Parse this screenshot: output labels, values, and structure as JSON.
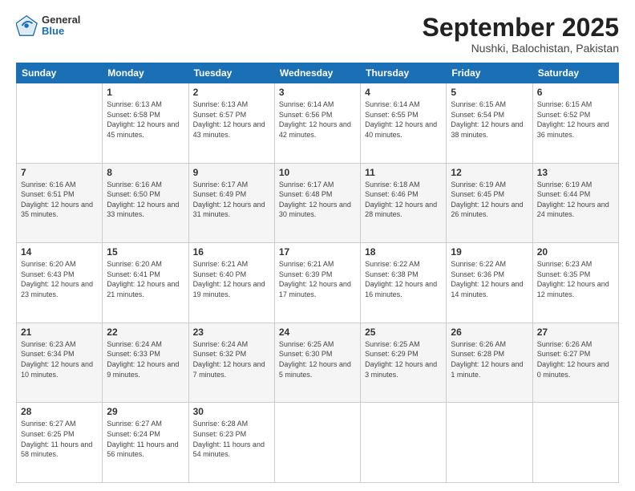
{
  "logo": {
    "general": "General",
    "blue": "Blue"
  },
  "header": {
    "month": "September 2025",
    "location": "Nushki, Balochistan, Pakistan"
  },
  "weekdays": [
    "Sunday",
    "Monday",
    "Tuesday",
    "Wednesday",
    "Thursday",
    "Friday",
    "Saturday"
  ],
  "weeks": [
    [
      {
        "day": "",
        "sunrise": "",
        "sunset": "",
        "daylight": ""
      },
      {
        "day": "1",
        "sunrise": "Sunrise: 6:13 AM",
        "sunset": "Sunset: 6:58 PM",
        "daylight": "Daylight: 12 hours and 45 minutes."
      },
      {
        "day": "2",
        "sunrise": "Sunrise: 6:13 AM",
        "sunset": "Sunset: 6:57 PM",
        "daylight": "Daylight: 12 hours and 43 minutes."
      },
      {
        "day": "3",
        "sunrise": "Sunrise: 6:14 AM",
        "sunset": "Sunset: 6:56 PM",
        "daylight": "Daylight: 12 hours and 42 minutes."
      },
      {
        "day": "4",
        "sunrise": "Sunrise: 6:14 AM",
        "sunset": "Sunset: 6:55 PM",
        "daylight": "Daylight: 12 hours and 40 minutes."
      },
      {
        "day": "5",
        "sunrise": "Sunrise: 6:15 AM",
        "sunset": "Sunset: 6:54 PM",
        "daylight": "Daylight: 12 hours and 38 minutes."
      },
      {
        "day": "6",
        "sunrise": "Sunrise: 6:15 AM",
        "sunset": "Sunset: 6:52 PM",
        "daylight": "Daylight: 12 hours and 36 minutes."
      }
    ],
    [
      {
        "day": "7",
        "sunrise": "Sunrise: 6:16 AM",
        "sunset": "Sunset: 6:51 PM",
        "daylight": "Daylight: 12 hours and 35 minutes."
      },
      {
        "day": "8",
        "sunrise": "Sunrise: 6:16 AM",
        "sunset": "Sunset: 6:50 PM",
        "daylight": "Daylight: 12 hours and 33 minutes."
      },
      {
        "day": "9",
        "sunrise": "Sunrise: 6:17 AM",
        "sunset": "Sunset: 6:49 PM",
        "daylight": "Daylight: 12 hours and 31 minutes."
      },
      {
        "day": "10",
        "sunrise": "Sunrise: 6:17 AM",
        "sunset": "Sunset: 6:48 PM",
        "daylight": "Daylight: 12 hours and 30 minutes."
      },
      {
        "day": "11",
        "sunrise": "Sunrise: 6:18 AM",
        "sunset": "Sunset: 6:46 PM",
        "daylight": "Daylight: 12 hours and 28 minutes."
      },
      {
        "day": "12",
        "sunrise": "Sunrise: 6:19 AM",
        "sunset": "Sunset: 6:45 PM",
        "daylight": "Daylight: 12 hours and 26 minutes."
      },
      {
        "day": "13",
        "sunrise": "Sunrise: 6:19 AM",
        "sunset": "Sunset: 6:44 PM",
        "daylight": "Daylight: 12 hours and 24 minutes."
      }
    ],
    [
      {
        "day": "14",
        "sunrise": "Sunrise: 6:20 AM",
        "sunset": "Sunset: 6:43 PM",
        "daylight": "Daylight: 12 hours and 23 minutes."
      },
      {
        "day": "15",
        "sunrise": "Sunrise: 6:20 AM",
        "sunset": "Sunset: 6:41 PM",
        "daylight": "Daylight: 12 hours and 21 minutes."
      },
      {
        "day": "16",
        "sunrise": "Sunrise: 6:21 AM",
        "sunset": "Sunset: 6:40 PM",
        "daylight": "Daylight: 12 hours and 19 minutes."
      },
      {
        "day": "17",
        "sunrise": "Sunrise: 6:21 AM",
        "sunset": "Sunset: 6:39 PM",
        "daylight": "Daylight: 12 hours and 17 minutes."
      },
      {
        "day": "18",
        "sunrise": "Sunrise: 6:22 AM",
        "sunset": "Sunset: 6:38 PM",
        "daylight": "Daylight: 12 hours and 16 minutes."
      },
      {
        "day": "19",
        "sunrise": "Sunrise: 6:22 AM",
        "sunset": "Sunset: 6:36 PM",
        "daylight": "Daylight: 12 hours and 14 minutes."
      },
      {
        "day": "20",
        "sunrise": "Sunrise: 6:23 AM",
        "sunset": "Sunset: 6:35 PM",
        "daylight": "Daylight: 12 hours and 12 minutes."
      }
    ],
    [
      {
        "day": "21",
        "sunrise": "Sunrise: 6:23 AM",
        "sunset": "Sunset: 6:34 PM",
        "daylight": "Daylight: 12 hours and 10 minutes."
      },
      {
        "day": "22",
        "sunrise": "Sunrise: 6:24 AM",
        "sunset": "Sunset: 6:33 PM",
        "daylight": "Daylight: 12 hours and 9 minutes."
      },
      {
        "day": "23",
        "sunrise": "Sunrise: 6:24 AM",
        "sunset": "Sunset: 6:32 PM",
        "daylight": "Daylight: 12 hours and 7 minutes."
      },
      {
        "day": "24",
        "sunrise": "Sunrise: 6:25 AM",
        "sunset": "Sunset: 6:30 PM",
        "daylight": "Daylight: 12 hours and 5 minutes."
      },
      {
        "day": "25",
        "sunrise": "Sunrise: 6:25 AM",
        "sunset": "Sunset: 6:29 PM",
        "daylight": "Daylight: 12 hours and 3 minutes."
      },
      {
        "day": "26",
        "sunrise": "Sunrise: 6:26 AM",
        "sunset": "Sunset: 6:28 PM",
        "daylight": "Daylight: 12 hours and 1 minute."
      },
      {
        "day": "27",
        "sunrise": "Sunrise: 6:26 AM",
        "sunset": "Sunset: 6:27 PM",
        "daylight": "Daylight: 12 hours and 0 minutes."
      }
    ],
    [
      {
        "day": "28",
        "sunrise": "Sunrise: 6:27 AM",
        "sunset": "Sunset: 6:25 PM",
        "daylight": "Daylight: 11 hours and 58 minutes."
      },
      {
        "day": "29",
        "sunrise": "Sunrise: 6:27 AM",
        "sunset": "Sunset: 6:24 PM",
        "daylight": "Daylight: 11 hours and 56 minutes."
      },
      {
        "day": "30",
        "sunrise": "Sunrise: 6:28 AM",
        "sunset": "Sunset: 6:23 PM",
        "daylight": "Daylight: 11 hours and 54 minutes."
      },
      {
        "day": "",
        "sunrise": "",
        "sunset": "",
        "daylight": ""
      },
      {
        "day": "",
        "sunrise": "",
        "sunset": "",
        "daylight": ""
      },
      {
        "day": "",
        "sunrise": "",
        "sunset": "",
        "daylight": ""
      },
      {
        "day": "",
        "sunrise": "",
        "sunset": "",
        "daylight": ""
      }
    ]
  ]
}
